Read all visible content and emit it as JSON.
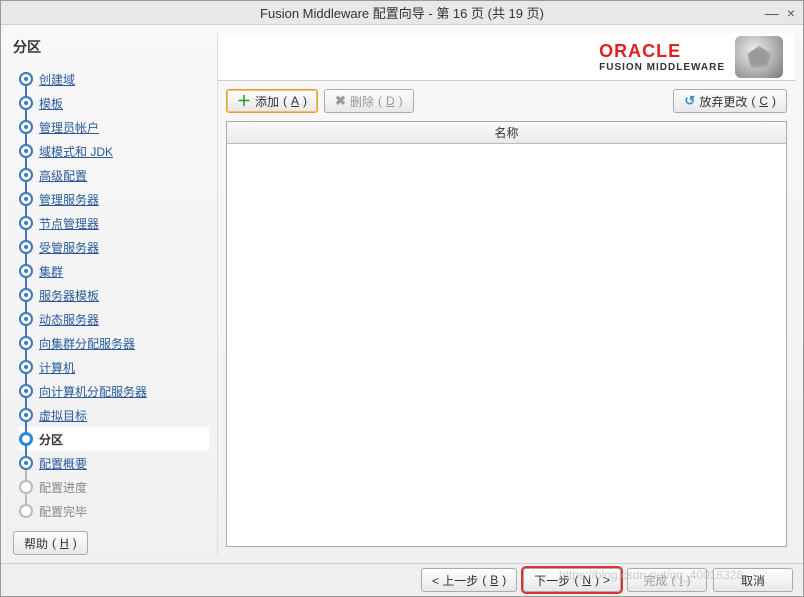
{
  "window": {
    "title": "Fusion Middleware 配置向导 - 第 16 页 (共 19 页)"
  },
  "section_title": "分区",
  "nav": [
    {
      "label": "创建域",
      "state": "done"
    },
    {
      "label": "模板",
      "state": "done"
    },
    {
      "label": "管理员帐户",
      "state": "done"
    },
    {
      "label": "域模式和 JDK",
      "state": "done"
    },
    {
      "label": "高级配置",
      "state": "done"
    },
    {
      "label": "管理服务器",
      "state": "done"
    },
    {
      "label": "节点管理器",
      "state": "done"
    },
    {
      "label": "受管服务器",
      "state": "done"
    },
    {
      "label": "集群",
      "state": "done"
    },
    {
      "label": "服务器模板",
      "state": "done"
    },
    {
      "label": "动态服务器",
      "state": "done"
    },
    {
      "label": "向集群分配服务器",
      "state": "done"
    },
    {
      "label": "计算机",
      "state": "done"
    },
    {
      "label": "向计算机分配服务器",
      "state": "done"
    },
    {
      "label": "虚拟目标",
      "state": "done"
    },
    {
      "label": "分区",
      "state": "current"
    },
    {
      "label": "配置概要",
      "state": "next"
    },
    {
      "label": "配置进度",
      "state": "future"
    },
    {
      "label": "配置完毕",
      "state": "future"
    }
  ],
  "brand": {
    "logo": "ORACLE",
    "sub": "FUSION MIDDLEWARE"
  },
  "toolbar": {
    "add": "添加",
    "add_key": "A",
    "delete": "删除",
    "delete_key": "D",
    "discard": "放弃更改",
    "discard_key": "C"
  },
  "grid": {
    "header": "名称"
  },
  "footer": {
    "help": "帮助",
    "help_key": "H",
    "back": "< 上一步",
    "back_key": "B",
    "next": "下一步",
    "next_key": "N",
    "next_suffix": ">",
    "finish": "完成",
    "finish_key": "I",
    "cancel": "取消"
  },
  "watermark": "https://blog.csdn.net/qq_40018328"
}
